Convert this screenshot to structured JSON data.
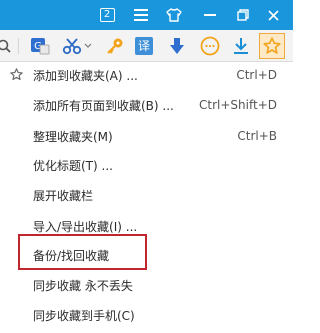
{
  "titlebar": {
    "badge_count": "2",
    "background": "#1a96dc",
    "icons": [
      "badge-icon",
      "menu-icon",
      "shirt-icon",
      "minimize-icon",
      "restore-icon",
      "close-icon"
    ]
  },
  "toolbar": {
    "icons": [
      "search-icon",
      "translate-icon",
      "scissors-icon",
      "key-icon",
      "yi-icon",
      "down-arrow-icon",
      "smile-icon",
      "download-icon",
      "star-icon"
    ],
    "yi_glyph": "译"
  },
  "menu": {
    "items": [
      {
        "label": "添加到收藏夹(A) ...",
        "shortcut": "Ctrl+D"
      },
      {
        "label": "添加所有页面到收藏(B) ...",
        "shortcut": "Ctrl+Shift+D"
      },
      {
        "label": "整理收藏夹(M)",
        "shortcut": "Ctrl+B"
      },
      {
        "label": "优化标题(T) ...",
        "shortcut": ""
      },
      {
        "label": "展开收藏栏",
        "shortcut": ""
      },
      {
        "label": "导入/导出收藏(I) ...",
        "shortcut": ""
      },
      {
        "label": "备份/找回收藏",
        "shortcut": ""
      },
      {
        "label": "同步收藏 永不丢失",
        "shortcut": ""
      },
      {
        "label": "同步收藏到手机(C)",
        "shortcut": ""
      }
    ],
    "highlight_color": "#c0262d"
  }
}
